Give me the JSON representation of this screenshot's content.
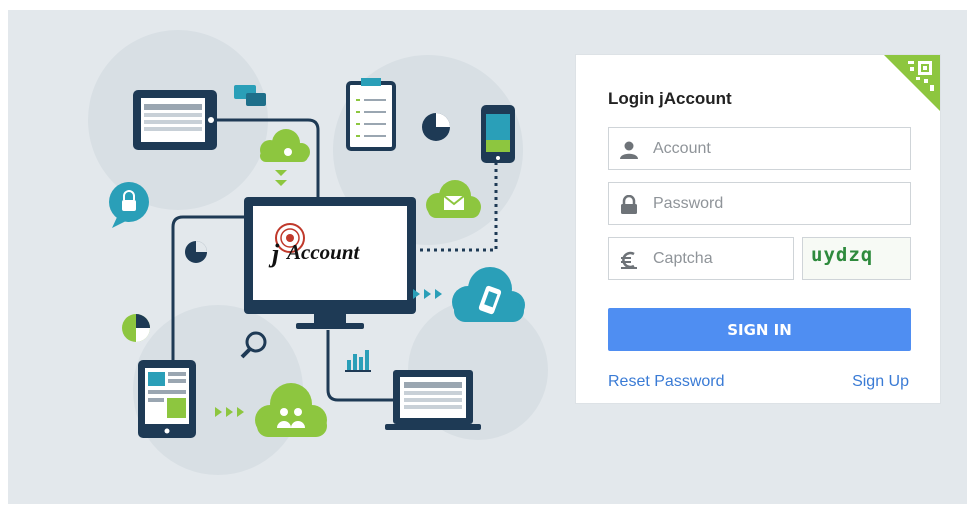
{
  "illustration": {
    "logo_text": "Account",
    "logo_initial": "j"
  },
  "login": {
    "title": "Login jAccount",
    "account_placeholder": "Account",
    "password_placeholder": "Password",
    "captcha_placeholder": "Captcha",
    "captcha_code": "uydzq",
    "signin_label": "SIGN IN",
    "reset_label": "Reset Password",
    "signup_label": "Sign Up"
  },
  "colors": {
    "accent": "#4f8ef2",
    "link": "#3a7bd5",
    "illustration_navy": "#1e3a55",
    "illustration_green": "#8dc63f",
    "illustration_teal": "#2a9fb8",
    "background": "#e3e8ec"
  },
  "icons": [
    "user-icon",
    "lock-icon",
    "euro-icon",
    "qr-code-icon"
  ]
}
